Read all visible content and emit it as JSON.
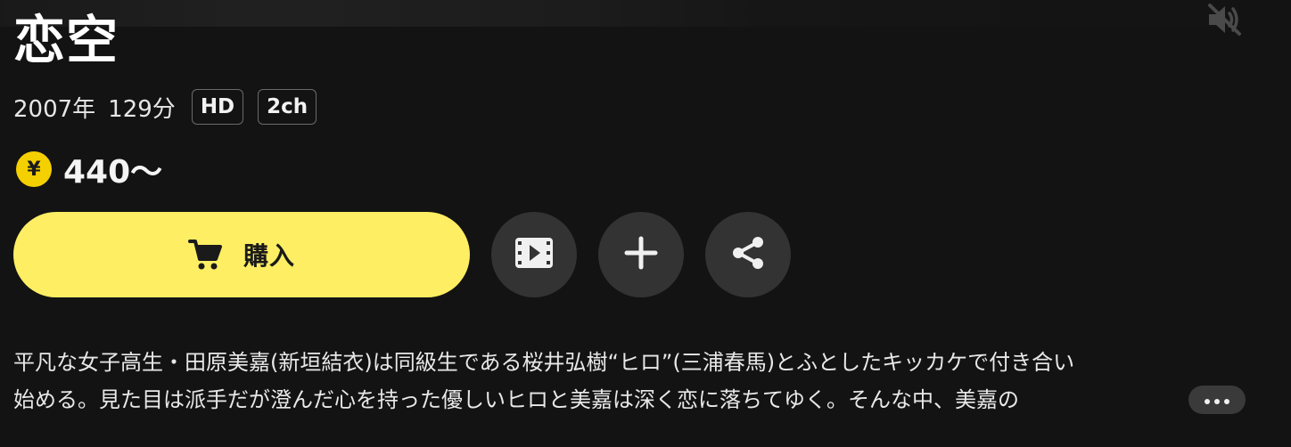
{
  "title": "恋空",
  "meta": {
    "year": "2007年",
    "duration": "129分",
    "badges": [
      "HD",
      "2ch"
    ]
  },
  "price": {
    "currency_symbol": "¥",
    "amount": "440〜"
  },
  "actions": {
    "buy_label": "購入",
    "trailer_icon": "film-play-icon",
    "add_icon": "plus-icon",
    "share_icon": "share-icon"
  },
  "description": {
    "line1": "平凡な女子高生・田原美嘉(新垣結衣)は同級生である桜井弘樹“ヒロ”(三浦春馬)とふとしたキッカケで付き合い",
    "line2": "始める。見た目は派手だが澄んだ心を持った優しいヒロと美嘉は深く恋に落ちてゆく。そんな中、美嘉の",
    "more_icon": "ellipsis-icon"
  },
  "audio": {
    "mute_icon": "speaker-muted-icon"
  },
  "colors": {
    "background": "#131313",
    "buy_button": "#fdee63",
    "coin": "#f5d000",
    "circle_button": "#333333"
  }
}
